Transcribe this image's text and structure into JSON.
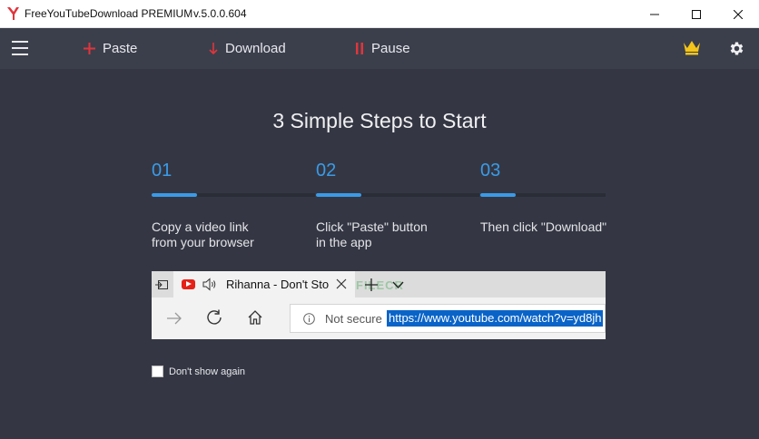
{
  "window": {
    "title": "FreeYouTubeDownload PREMIUM",
    "version": "v.5.0.0.604"
  },
  "toolbar": {
    "paste_label": "Paste",
    "download_label": "Download",
    "pause_label": "Pause"
  },
  "colors": {
    "accent": "#3a9be8",
    "toolbar_bg": "#3b3f4c",
    "main_bg": "#343743",
    "icon_red": "#e0353b",
    "crown": "#f5c518"
  },
  "main": {
    "heading": "3 Simple Steps to Start",
    "steps": [
      {
        "number": "01",
        "line1": "Copy a video link",
        "line2": "from your browser",
        "progress": 0.28
      },
      {
        "number": "02",
        "line1": "Click \"Paste\" button",
        "line2": "in the app",
        "progress": 0.28
      },
      {
        "number": "03",
        "line1": "Then click \"Download\"",
        "line2": "",
        "progress": 0.28
      }
    ],
    "browser": {
      "tab_title": "Rihanna - Don't Stop",
      "watermark": "FILECR",
      "not_secure": "Not secure",
      "url": "https://www.youtube.com/watch?v=yd8jh"
    },
    "dont_show_again": "Don't show again",
    "dont_show_checked": false
  }
}
